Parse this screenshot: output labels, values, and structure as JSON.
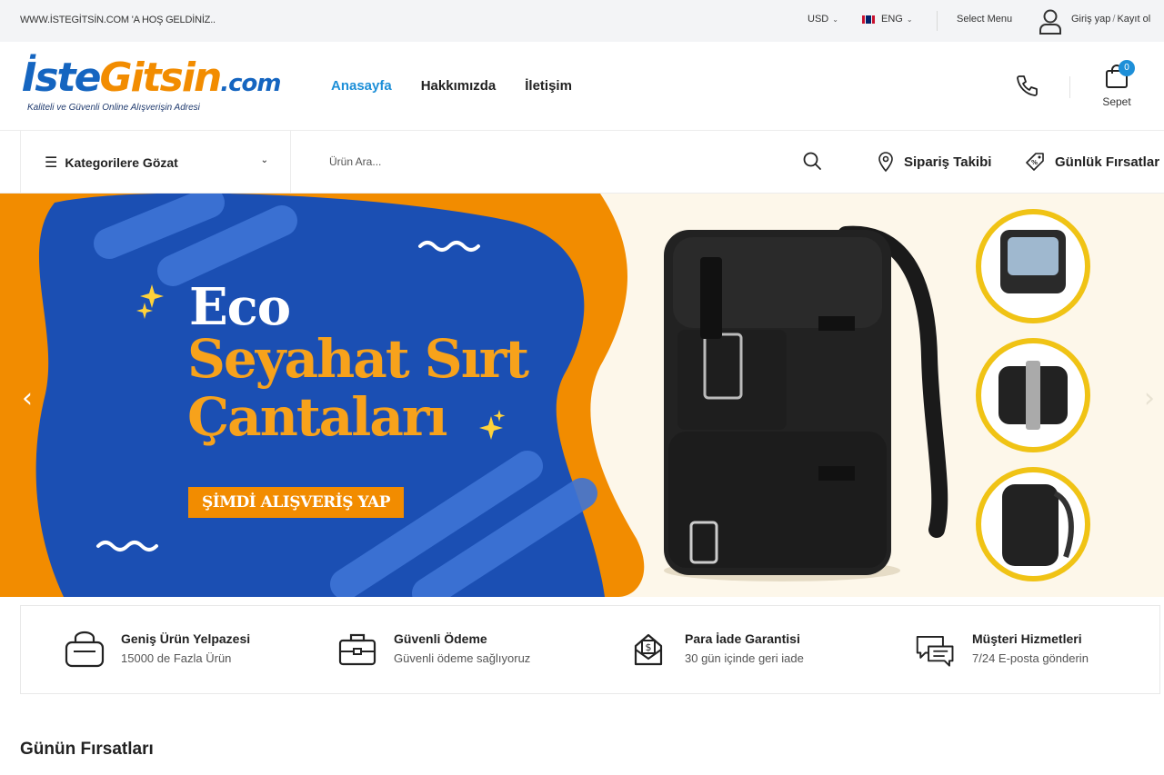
{
  "topbar": {
    "welcome": "WWW.İSTEGİTSİN.COM 'A HOŞ GELDİNİZ..",
    "currency": "USD",
    "language": "ENG",
    "select_menu": "Select Menu",
    "login": "Giriş yap",
    "register": "Kayıt ol"
  },
  "header": {
    "logo": {
      "part1": "İste",
      "part2": "Gitsin",
      "part3": ".com",
      "tagline": "Kaliteli ve Güvenli Online Alışverişin Adresi"
    },
    "nav": [
      {
        "label": "Anasayfa",
        "active": true
      },
      {
        "label": "Hakkımızda",
        "active": false
      },
      {
        "label": "İletişim",
        "active": false
      }
    ],
    "cart_count": "0",
    "cart_label": "Sepet"
  },
  "catrow": {
    "categories_label": "Kategorilere Gözat",
    "search_placeholder": "Ürün Ara...",
    "order_tracking": "Sipariş Takibi",
    "daily_deals": "Günlük Fırsatlar"
  },
  "hero": {
    "line1": "Eco",
    "line2": "Seyahat Sırt",
    "line3": "Çantaları",
    "cta": "ŞİMDİ ALIŞVERİŞ YAP",
    "colors": {
      "blue": "#1b4fb3",
      "orange": "#f28c00",
      "cream": "#fdf7ea"
    }
  },
  "features": [
    {
      "icon": "bag-icon",
      "title": "Geniş Ürün Yelpazesi",
      "subtitle": "15000 de Fazla Ürün"
    },
    {
      "icon": "briefcase-icon",
      "title": "Güvenli Ödeme",
      "subtitle": "Güvenli ödeme sağlıyoruz"
    },
    {
      "icon": "money-envelope-icon",
      "title": "Para İade Garantisi",
      "subtitle": "30 gün içinde geri iade"
    },
    {
      "icon": "chat-icon",
      "title": "Müşteri Hizmetleri",
      "subtitle": "7/24 E-posta gönderin"
    }
  ],
  "section": {
    "title": "Günün Fırsatları"
  },
  "colors": {
    "accent": "#1d8fd8",
    "brand_blue": "#1565c0",
    "brand_orange": "#f28c00"
  }
}
